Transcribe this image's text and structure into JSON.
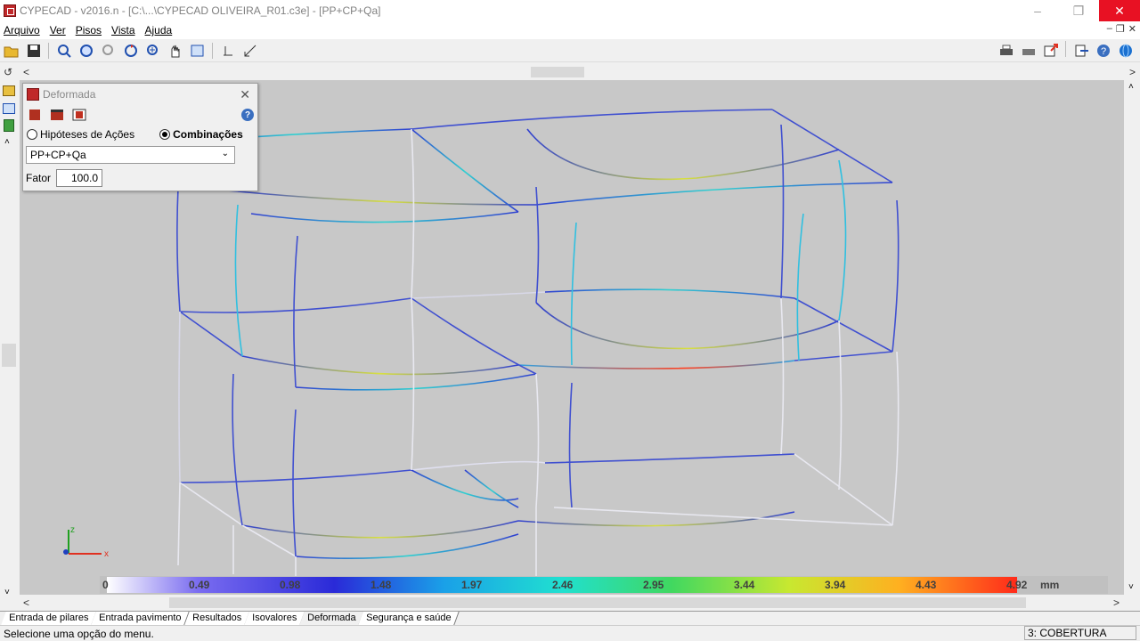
{
  "window": {
    "title": "CYPECAD - v2016.n - [C:\\...\\CYPECAD OLIVEIRA_R01.c3e] - [PP+CP+Qa]"
  },
  "menu": [
    "Arquivo",
    "Ver",
    "Pisos",
    "Vista",
    "Ajuda"
  ],
  "dialog": {
    "title": "Deformada",
    "radio_hipoteses": "Hipóteses de Ações",
    "radio_combinacoes": "Combinações",
    "combination_value": "PP+CP+Qa",
    "fator_label": "Fator",
    "fator_value": "100.0"
  },
  "legend": {
    "values": [
      "0",
      "0.49",
      "0.98",
      "1.48",
      "1.97",
      "2.46",
      "2.95",
      "3.44",
      "3.94",
      "4.43",
      "4.92"
    ],
    "unit": "mm"
  },
  "axes": {
    "z": "z",
    "x": "x"
  },
  "tabs": [
    "Entrada de pilares",
    "Entrada pavimento",
    "Resultados",
    "Isovalores",
    "Deformada",
    "Segurança e saúde"
  ],
  "active_tab": "Deformada",
  "status": {
    "message": "Selecione uma opção do menu.",
    "floor": "3: COBERTURA"
  },
  "colors": {
    "close_button": "#e81123",
    "viewport_bg": "#c8c8c8"
  }
}
